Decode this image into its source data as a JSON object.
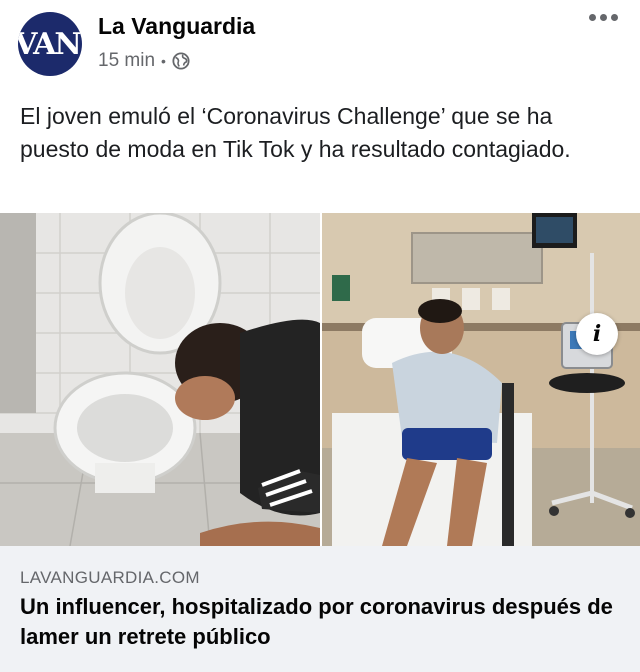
{
  "post": {
    "page_name": "La Vanguardia",
    "avatar_text": "VAN",
    "timestamp": "15 min",
    "separator": "•",
    "privacy_icon": "globe-icon",
    "more_icon": "more-options-icon",
    "caption": "El joven emuló el ‘Coronavirus Challenge’ que se ha puesto de moda en Tik Tok y ha resultado contagiado."
  },
  "link_preview": {
    "domain": "LAVANGUARDIA.COM",
    "title": "Un influencer, hospitalizado por coronavirus después de lamer un retrete público",
    "info_icon_label": "i"
  },
  "colors": {
    "avatar_bg": "#1c2a6b",
    "meta_text": "#65676b",
    "preview_bg": "#f0f2f5"
  }
}
